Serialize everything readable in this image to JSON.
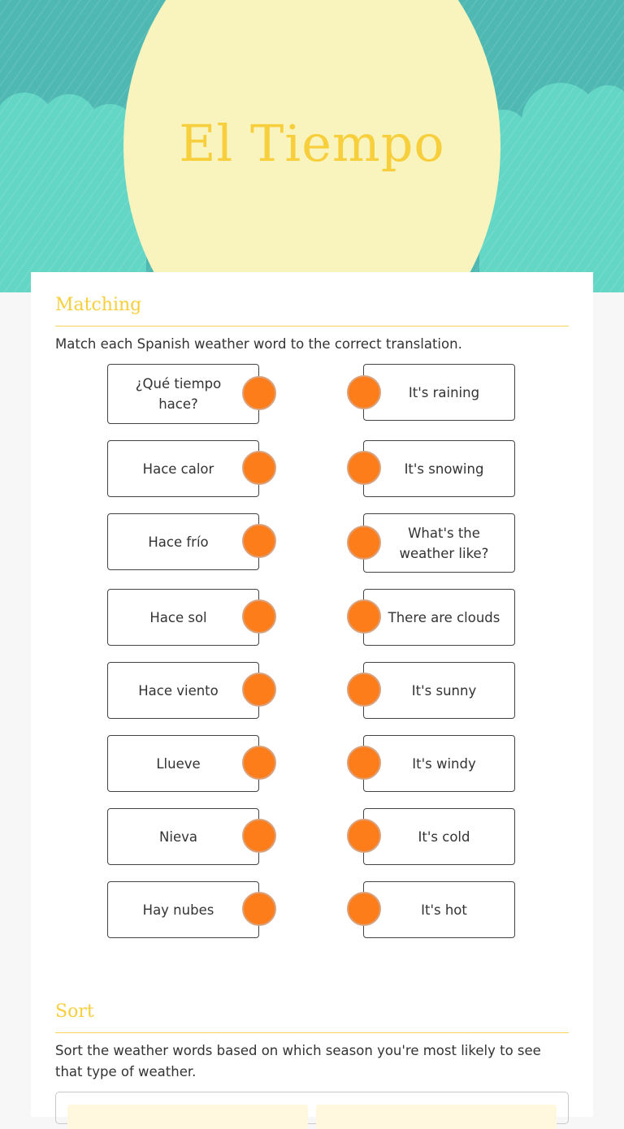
{
  "header": {
    "title": "El Tiempo",
    "colors": {
      "sky": "#4fb8b2",
      "clouds": "#63d6c6",
      "sun": "#f9f4bd",
      "title": "#f7cf3c"
    }
  },
  "matching": {
    "heading": "Matching",
    "instructions": "Match each Spanish weather word to the correct translation.",
    "left_items": [
      "¿Qué tiempo hace?",
      "Hace calor",
      "Hace frío",
      "Hace sol",
      "Hace viento",
      "Llueve",
      "Nieva",
      "Hay nubes"
    ],
    "right_items": [
      "It's raining",
      "It's snowing",
      "What's the weather like?",
      "There are clouds",
      "It's sunny",
      "It's windy",
      "It's cold",
      "It's hot"
    ],
    "connector_color": "#fd7d1a"
  },
  "sort": {
    "heading": "Sort",
    "instructions": "Sort the weather words based on which season you're most likely to see that type of weather."
  }
}
